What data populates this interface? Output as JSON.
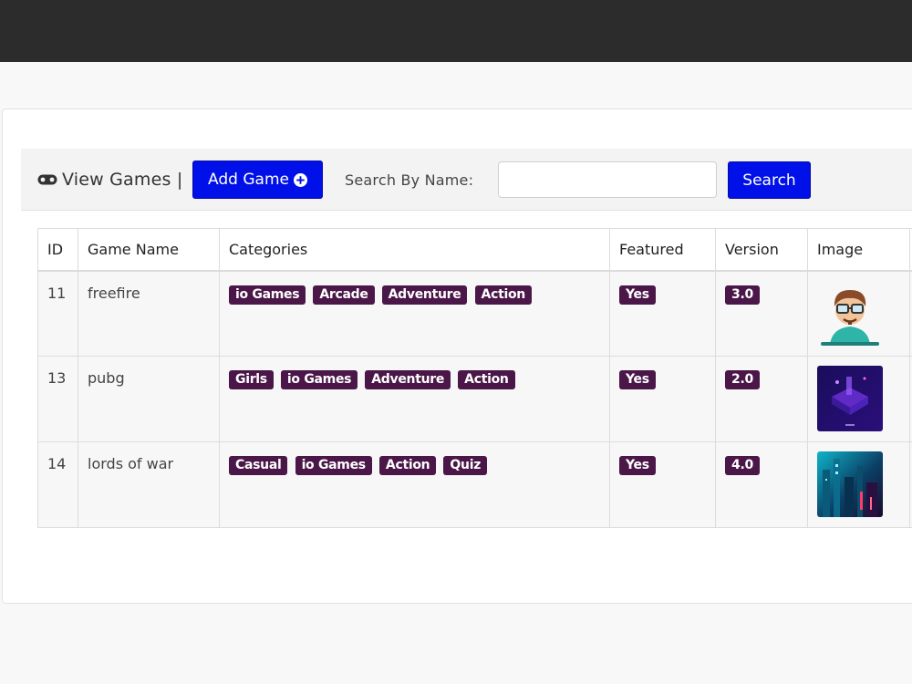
{
  "toolbar": {
    "title": "View Games |",
    "add_label": "Add Game",
    "search_label": "Search By Name:",
    "search_value": "",
    "search_placeholder": "",
    "search_button": "Search"
  },
  "table": {
    "headers": [
      "ID",
      "Game Name",
      "Categories",
      "Featured",
      "Version",
      "Image"
    ],
    "rows": [
      {
        "id": "11",
        "name": "freefire",
        "categories": [
          "io Games",
          "Arcade",
          "Adventure",
          "Action"
        ],
        "featured": "Yes",
        "version": "3.0",
        "image_icon": "gamer-avatar-icon"
      },
      {
        "id": "13",
        "name": "pubg",
        "categories": [
          "Girls",
          "io Games",
          "Adventure",
          "Action"
        ],
        "featured": "Yes",
        "version": "2.0",
        "image_icon": "purple-3d-icon"
      },
      {
        "id": "14",
        "name": "lords of war",
        "categories": [
          "Casual",
          "io Games",
          "Action",
          "Quiz"
        ],
        "featured": "Yes",
        "version": "4.0",
        "image_icon": "neon-city-icon"
      }
    ]
  },
  "colors": {
    "topbar": "#2c2c2c",
    "button": "#0010e8",
    "badge": "#4a1748"
  }
}
